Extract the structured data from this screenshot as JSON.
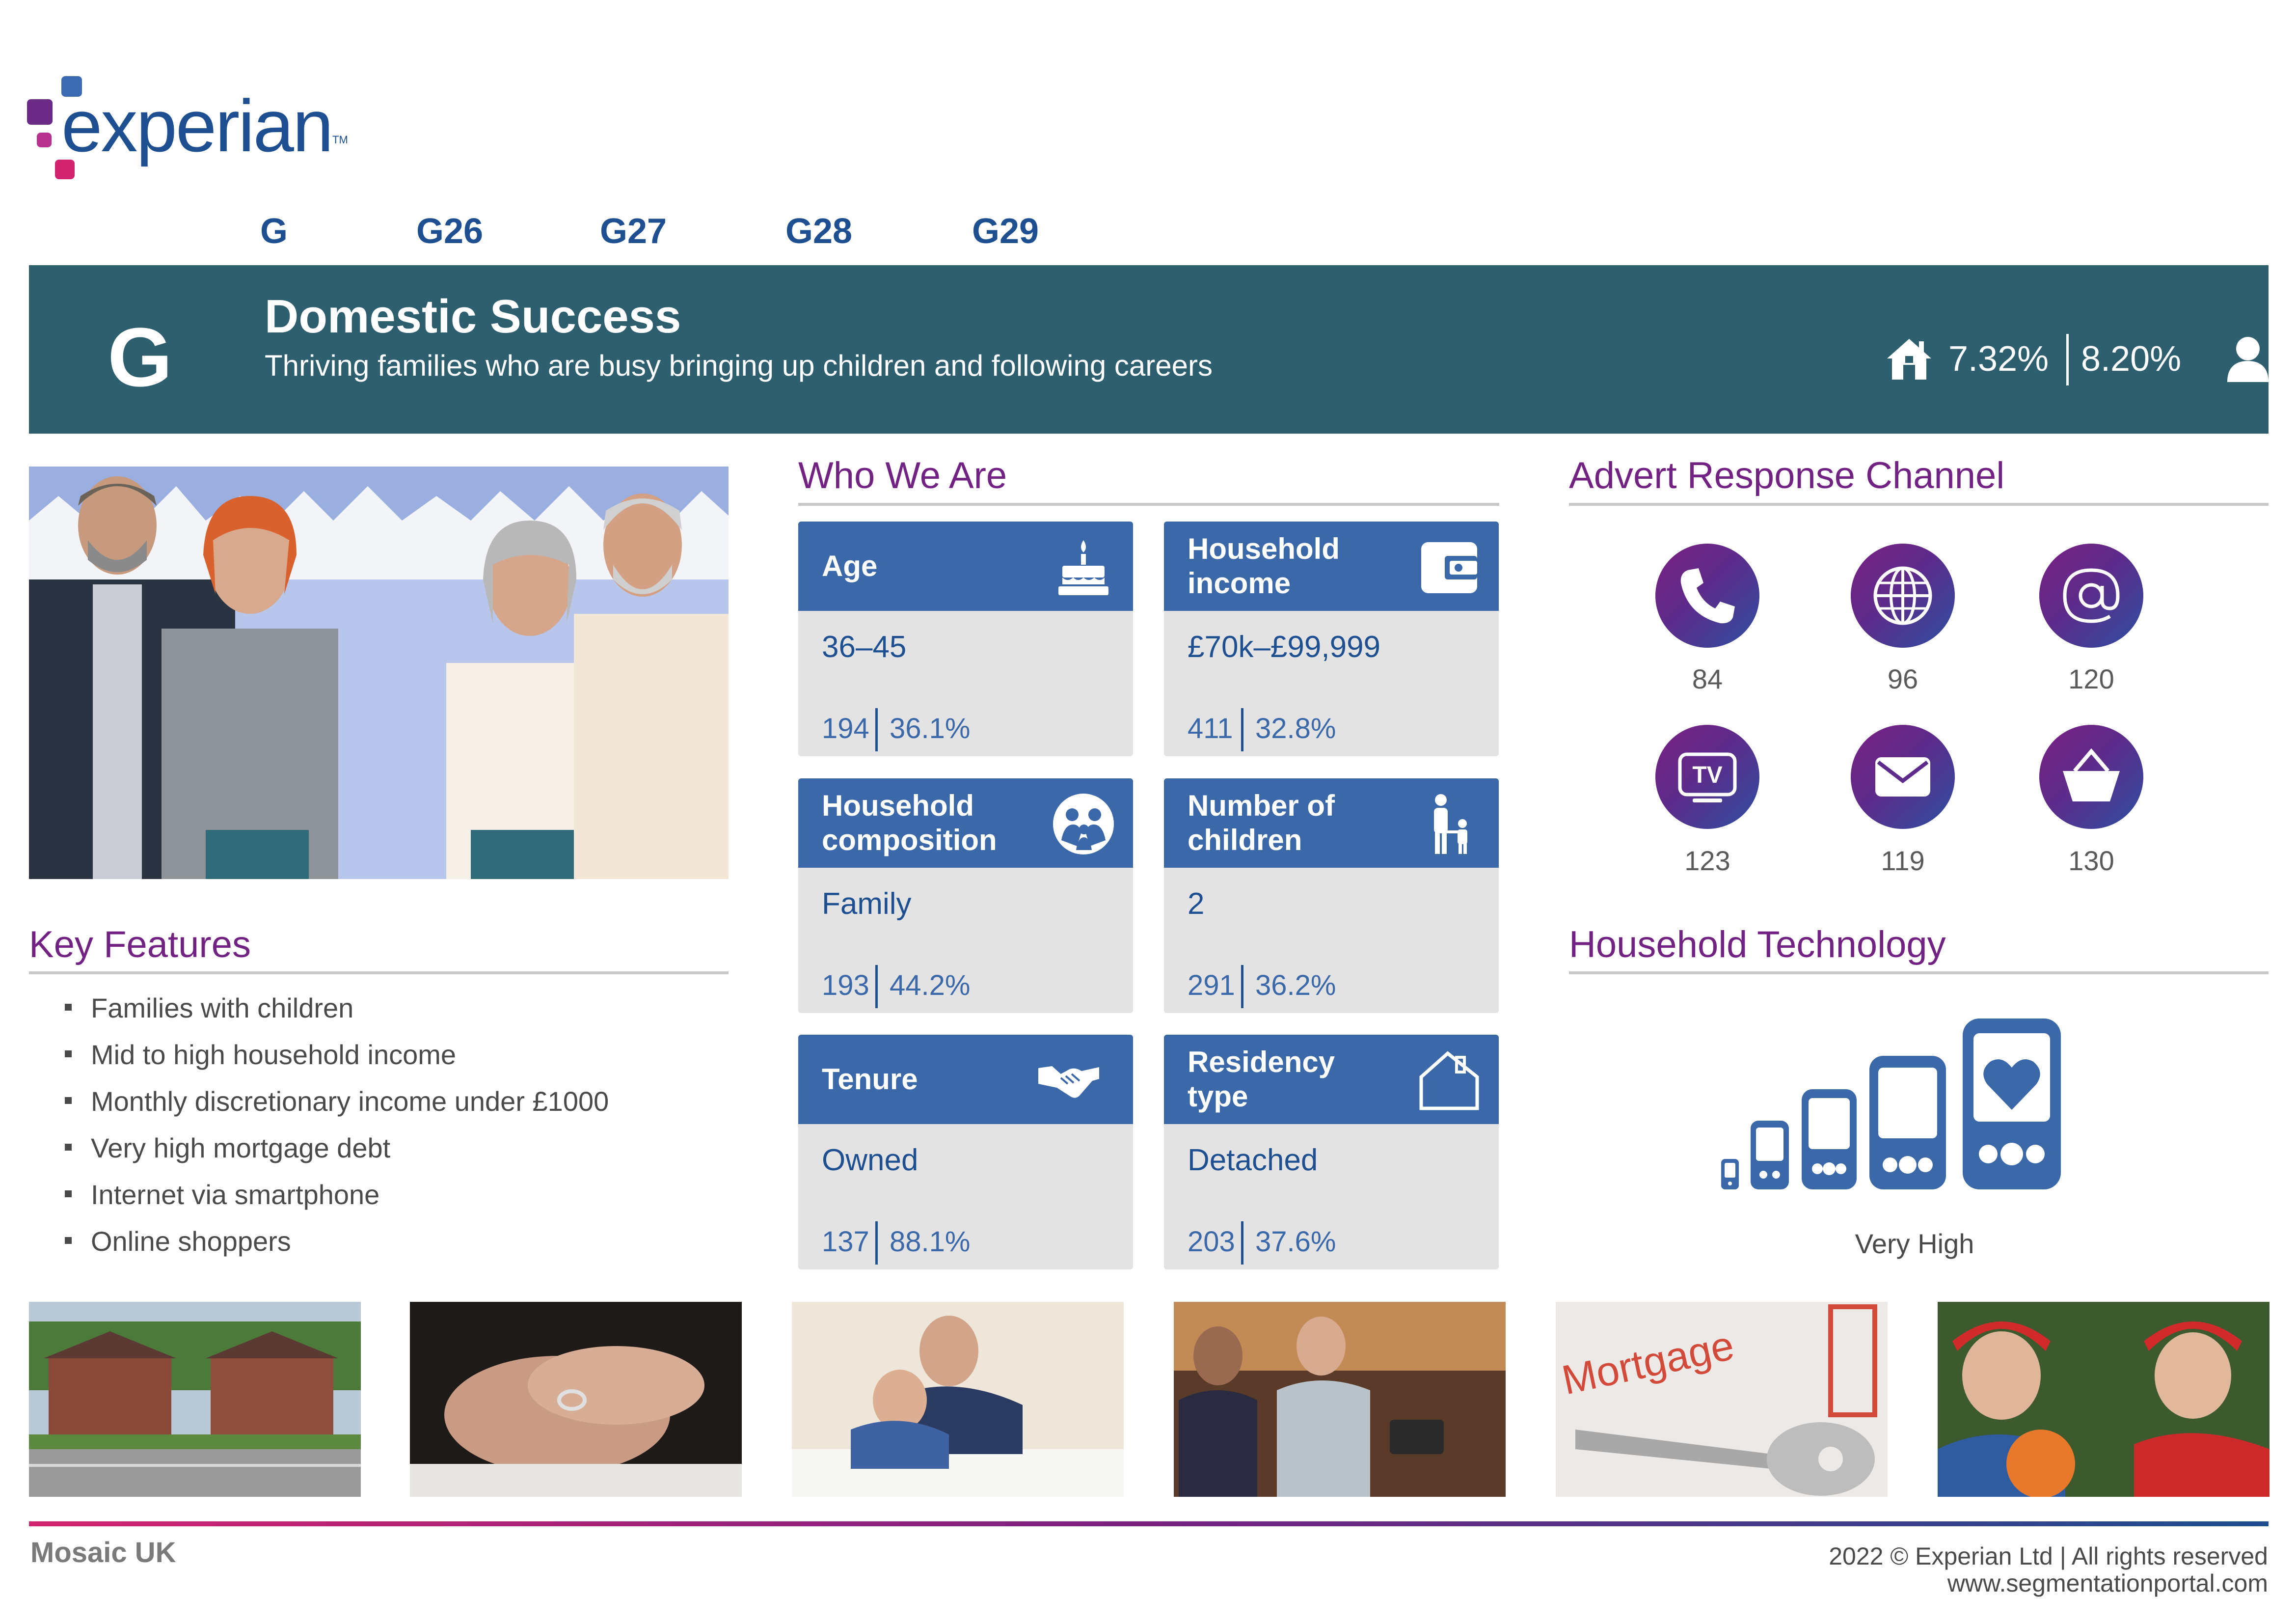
{
  "brand": {
    "name": "experian",
    "trademark": "TM"
  },
  "tabs": [
    "G",
    "G26",
    "G27",
    "G28",
    "G29"
  ],
  "banner": {
    "letter": "G",
    "title": "Domestic Success",
    "subtitle": "Thriving families who are busy bringing up children and following careers",
    "households_pct": "7.32%",
    "population_pct": "8.20%"
  },
  "sections": {
    "key_features": "Key Features",
    "who_we_are": "Who We Are",
    "advert_response": "Advert Response Channel",
    "household_tech": "Household Technology"
  },
  "key_features": [
    "Families with children",
    "Mid to high household income",
    "Monthly discretionary income under £1000",
    "Very high mortgage debt",
    "Internet via smartphone",
    "Online shoppers"
  ],
  "who_we_are": [
    {
      "label": "Age",
      "icon": "birthday-cake-icon",
      "value": "36–45",
      "index": "194",
      "pct": "36.1%"
    },
    {
      "label": "Household income",
      "icon": "wallet-icon",
      "value": "£70k–£99,999",
      "index": "411",
      "pct": "32.8%"
    },
    {
      "label": "Household composition",
      "icon": "family-icon",
      "value": "Family",
      "index": "193",
      "pct": "44.2%"
    },
    {
      "label": "Number of children",
      "icon": "parent-child-icon",
      "value": "2",
      "index": "291",
      "pct": "36.2%"
    },
    {
      "label": "Tenure",
      "icon": "handshake-icon",
      "value": "Owned",
      "index": "137",
      "pct": "88.1%"
    },
    {
      "label": "Residency type",
      "icon": "house-outline-icon",
      "value": "Detached",
      "index": "203",
      "pct": "37.6%"
    }
  ],
  "advert_channels": [
    {
      "icon": "phone-icon",
      "value": "84"
    },
    {
      "icon": "globe-icon",
      "value": "96"
    },
    {
      "icon": "at-sign-icon",
      "value": "120"
    },
    {
      "icon": "tv-icon",
      "value": "123"
    },
    {
      "icon": "envelope-icon",
      "value": "119"
    },
    {
      "icon": "shopping-basket-icon",
      "value": "130"
    }
  ],
  "household_technology": {
    "level": "Very High",
    "level_rank": 5,
    "level_max": 5
  },
  "photos": [
    "houses-photo",
    "wedding-ring-photo",
    "father-son-homework-photo",
    "card-payment-photo",
    "mortgage-keys-photo",
    "boys-football-photo"
  ],
  "colors": {
    "banner": "#2d5f6e",
    "card_header": "#3a68a8",
    "card_body": "#e3e3e4",
    "heading": "#722282",
    "brand_blue": "#1d4f91",
    "brand_magenta": "#d2246f"
  },
  "footer": {
    "product": "Mosaic UK",
    "copyright": "2022 © Experian Ltd | All rights reserved",
    "url": "www.segmentationportal.com"
  }
}
